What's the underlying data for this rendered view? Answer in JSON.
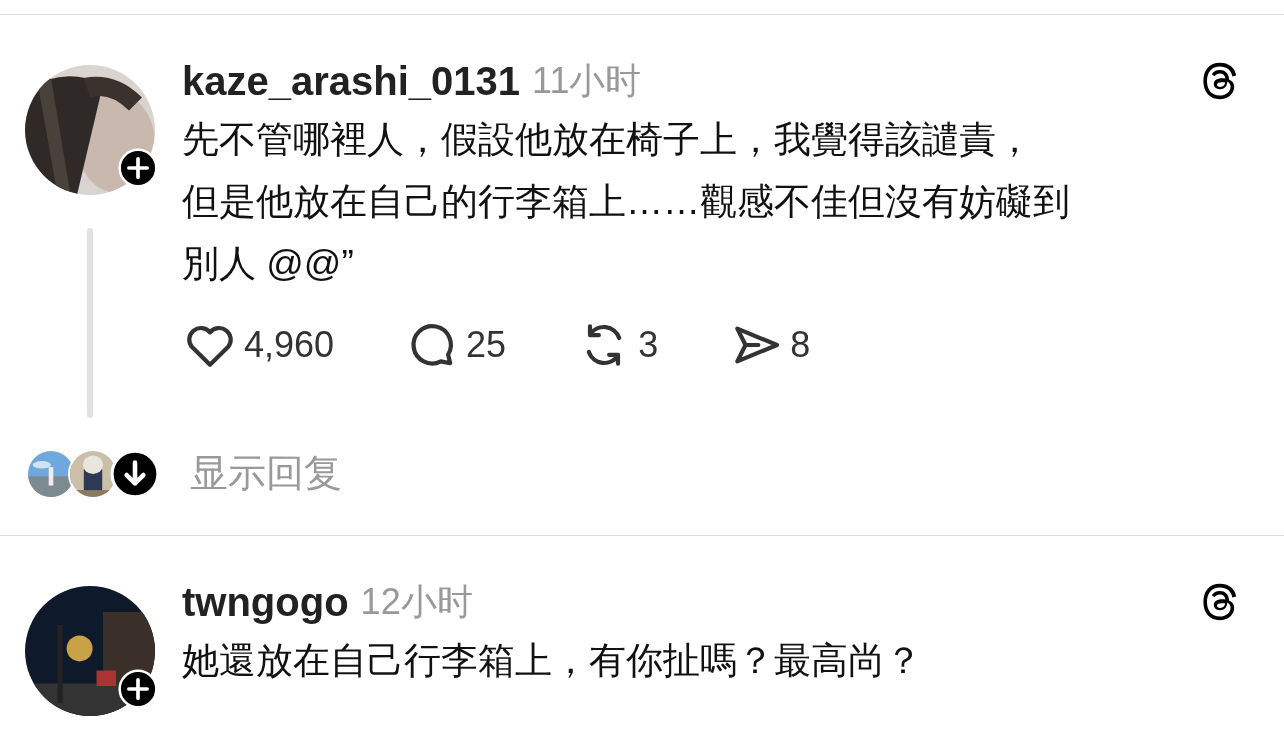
{
  "posts": [
    {
      "username": "kaze_arashi_0131",
      "time": "11小时",
      "lines": [
        "先不管哪裡人，假設他放在椅子上，我覺得該譴責，",
        "但是他放在自己的行李箱上……觀感不佳但沒有妨礙到",
        "別人 @@”"
      ],
      "avatar": {
        "kind": "picture"
      },
      "actions": [
        {
          "kind": "like",
          "count": "4,960"
        },
        {
          "kind": "reply",
          "count": "25"
        },
        {
          "kind": "repost",
          "count": "3"
        },
        {
          "kind": "share",
          "count": "8"
        }
      ],
      "replies": {
        "label": "显示回复",
        "avatars": [
          {
            "kind": "picture"
          },
          {
            "kind": "picture"
          }
        ]
      }
    },
    {
      "username": "twngogo",
      "time": "12小时",
      "lines": [
        "她還放在自己行李箱上，有你扯嗎？最高尚？"
      ],
      "avatar": {
        "kind": "picture"
      }
    }
  ]
}
